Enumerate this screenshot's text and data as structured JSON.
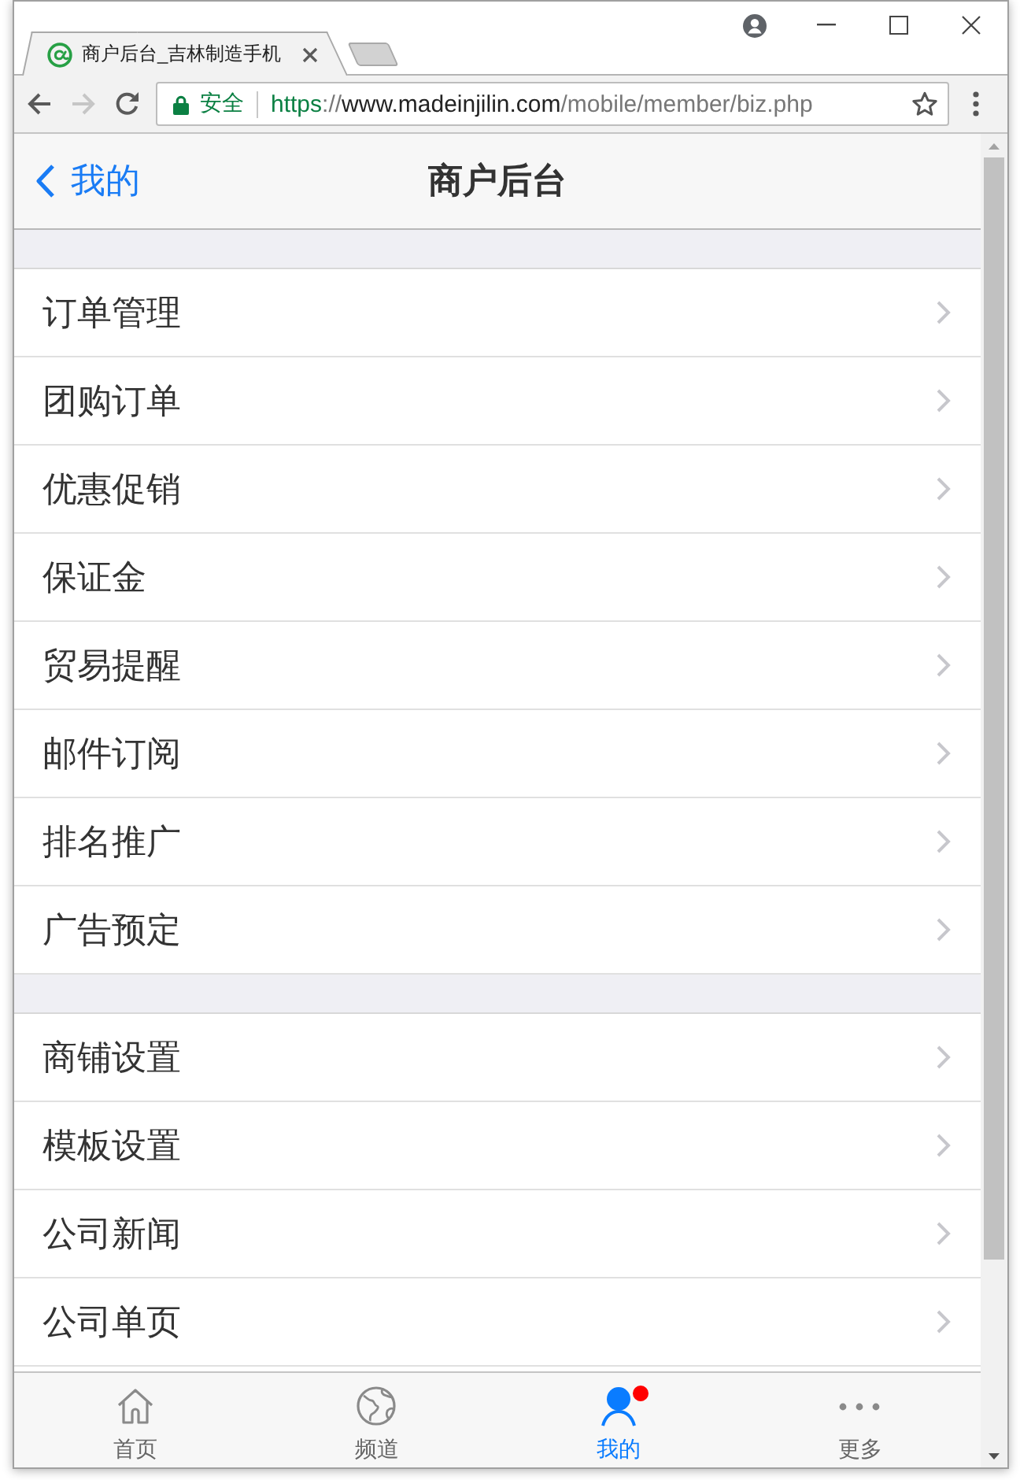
{
  "browser": {
    "tabs": [
      {
        "title": "商户后台_吉林制造手机",
        "selected": true
      }
    ],
    "navigation": [
      {
        "kind": "back",
        "disabled": false
      },
      {
        "kind": "forward",
        "disabled": true
      },
      {
        "kind": "reload",
        "disabled": false
      }
    ],
    "address_bar": {
      "security_label": "安全",
      "url": {
        "scheme": "https",
        "separator": "://",
        "host": "www.madeinjilin.com",
        "path": "/mobile/member/biz.php"
      }
    }
  },
  "header": {
    "back_label": "我的",
    "title": "商户后台"
  },
  "menu_groups": [
    {
      "items": [
        {
          "label": "订单管理"
        },
        {
          "label": "团购订单"
        },
        {
          "label": "优惠促销"
        },
        {
          "label": "保证金"
        },
        {
          "label": "贸易提醒"
        },
        {
          "label": "邮件订阅"
        },
        {
          "label": "排名推广"
        },
        {
          "label": "广告预定"
        }
      ]
    },
    {
      "items": [
        {
          "label": "商铺设置"
        },
        {
          "label": "模板设置"
        },
        {
          "label": "公司新闻"
        },
        {
          "label": "公司单页"
        }
      ]
    }
  ],
  "tab_bar": [
    {
      "label": "首页",
      "kind": "home",
      "selected": false,
      "badge": false
    },
    {
      "label": "频道",
      "kind": "globe",
      "selected": false,
      "badge": false
    },
    {
      "label": "我的",
      "kind": "person",
      "selected": true,
      "badge": true
    },
    {
      "label": "更多",
      "kind": "more",
      "selected": false,
      "badge": false
    }
  ]
}
